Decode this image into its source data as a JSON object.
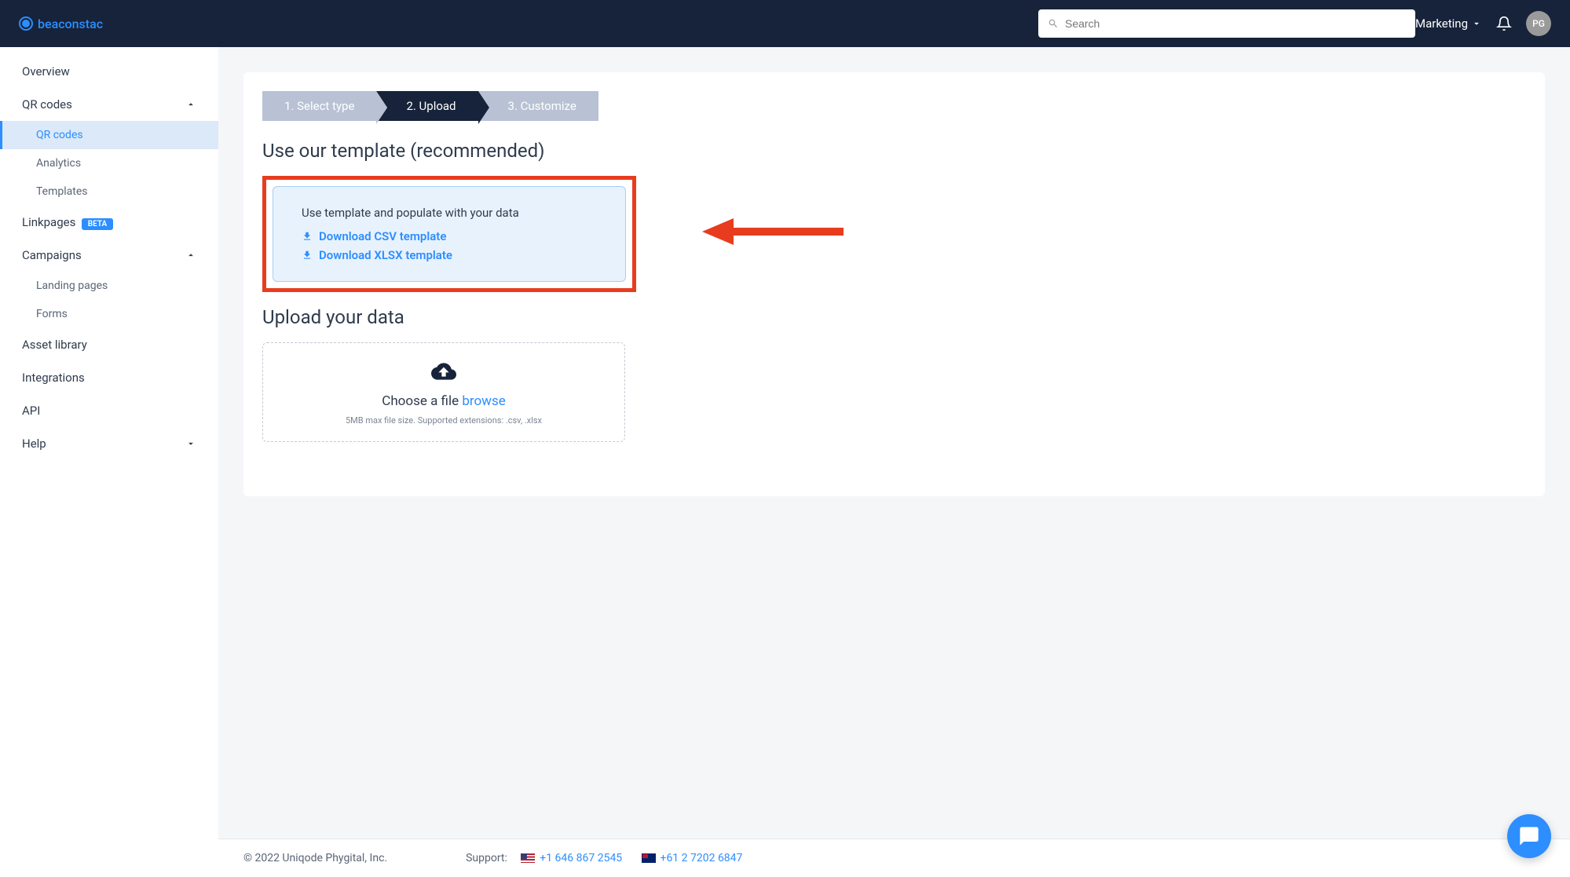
{
  "brand": "beaconstac",
  "search": {
    "placeholder": "Search"
  },
  "header": {
    "org_label": "Marketing",
    "avatar_initials": "PG"
  },
  "sidebar": {
    "items": [
      {
        "label": "Overview"
      },
      {
        "label": "QR codes",
        "expanded": true,
        "children": [
          {
            "label": "QR codes",
            "active": true
          },
          {
            "label": "Analytics"
          },
          {
            "label": "Templates"
          }
        ]
      },
      {
        "label": "Linkpages",
        "badge": "BETA"
      },
      {
        "label": "Campaigns",
        "expanded": true,
        "children": [
          {
            "label": "Landing pages"
          },
          {
            "label": "Forms"
          }
        ]
      },
      {
        "label": "Asset library"
      },
      {
        "label": "Integrations"
      },
      {
        "label": "API"
      },
      {
        "label": "Help",
        "expandable": true
      }
    ]
  },
  "stepper": {
    "steps": [
      {
        "label": "1. Select type"
      },
      {
        "label": "2. Upload",
        "active": true
      },
      {
        "label": "3. Customize"
      }
    ]
  },
  "template_section": {
    "heading": "Use our template (recommended)",
    "desc": "Use template and populate with your data",
    "csv_label": "Download CSV template",
    "xlsx_label": "Download XLSX template"
  },
  "upload_section": {
    "heading": "Upload your data",
    "choose_text": "Choose a file ",
    "browse": "browse",
    "hint": "5MB max file size. Supported extensions: .csv, .xlsx"
  },
  "footer": {
    "copyright": "© 2022 Uniqode Phygital, Inc.",
    "support_label": "Support:",
    "phone_us": "+1 646 867 2545",
    "phone_au": "+61 2 7202 6847"
  }
}
